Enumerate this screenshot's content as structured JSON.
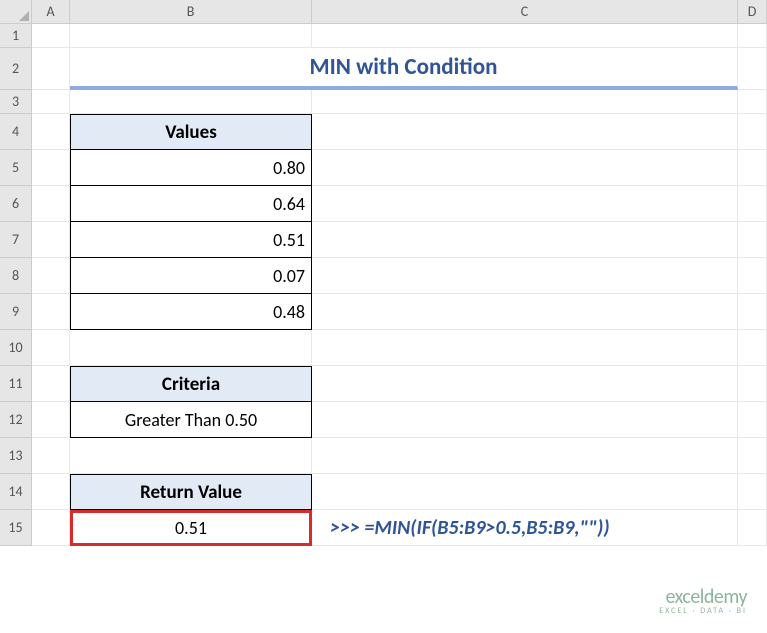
{
  "columns": [
    "A",
    "B",
    "C",
    "D"
  ],
  "rows": [
    "1",
    "2",
    "3",
    "4",
    "5",
    "6",
    "7",
    "8",
    "9",
    "10",
    "11",
    "12",
    "13",
    "14",
    "15"
  ],
  "title": "MIN with Condition",
  "values_header": "Values",
  "values": [
    "0.80",
    "0.64",
    "0.51",
    "0.07",
    "0.48"
  ],
  "criteria_header": "Criteria",
  "criteria_value": "Greater Than 0.50",
  "return_header": "Return Value",
  "return_value": "0.51",
  "formula": ">>> =MIN(IF(B5:B9>0.5,B5:B9,\"\"))",
  "watermark": {
    "brand": "exceldemy",
    "tag": "EXCEL · DATA · BI"
  },
  "chart_data": {
    "type": "table",
    "title": "MIN with Condition",
    "datasets": [
      {
        "name": "Values",
        "values": [
          0.8,
          0.64,
          0.51,
          0.07,
          0.48
        ]
      }
    ],
    "criteria": "Greater Than 0.50",
    "result": 0.51,
    "formula": "=MIN(IF(B5:B9>0.5,B5:B9,\"\"))"
  }
}
